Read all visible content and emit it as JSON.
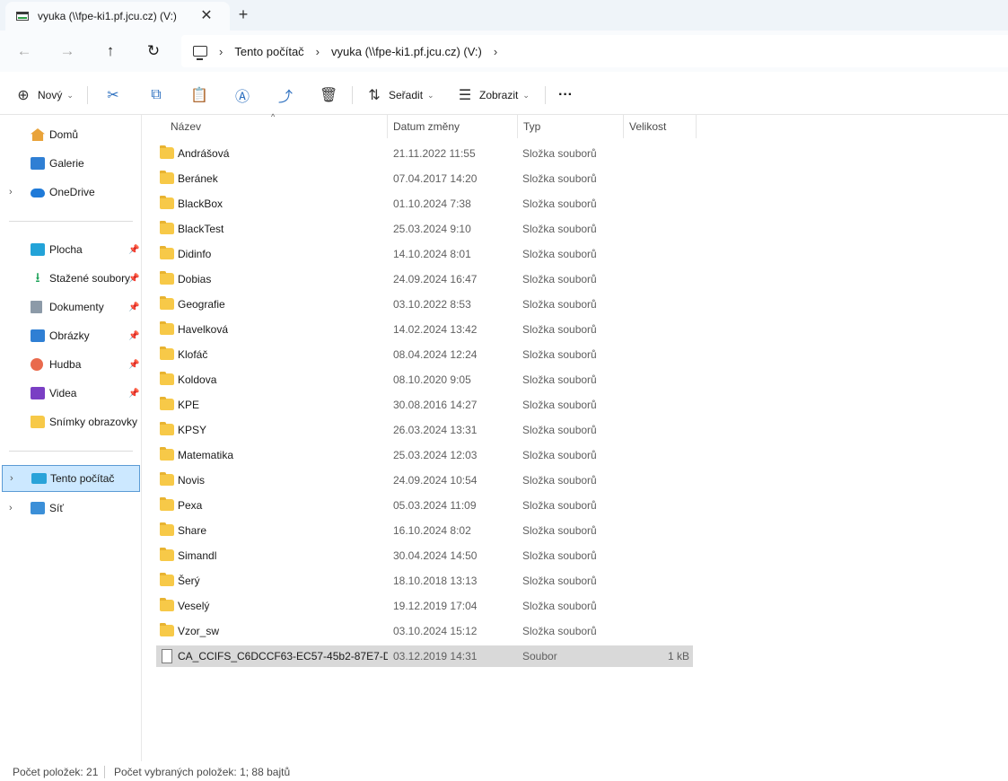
{
  "tab": {
    "title": "vyuka (\\\\fpe-ki1.pf.jcu.cz) (V:)",
    "close": "✕",
    "add": "+"
  },
  "nav": {
    "back": "←",
    "forward": "→",
    "up": "↑",
    "refresh": "↻"
  },
  "breadcrumb": [
    "Tento počítač",
    "vyuka (\\\\fpe-ki1.pf.jcu.cz) (V:)"
  ],
  "toolbar": {
    "new_label": "Nový",
    "sort_label": "Seřadit",
    "view_label": "Zobrazit",
    "more_label": "···",
    "icons": {
      "new": "⊕",
      "cut": "✂",
      "copy": "⧉",
      "paste": "📋",
      "rename": "Ⓐ",
      "share": "⤴",
      "delete": "🗑",
      "sort": "⇅",
      "view": "☰"
    }
  },
  "sidebar": {
    "top": [
      {
        "label": "Domů",
        "icon": "home-icon"
      },
      {
        "label": "Galerie",
        "icon": "gallery-icon"
      },
      {
        "label": "OneDrive",
        "icon": "cloud-icon",
        "expandable": true
      }
    ],
    "pinned": [
      {
        "label": "Plocha",
        "icon": "desktop-icon",
        "pinned": true
      },
      {
        "label": "Stažené soubory",
        "icon": "download-icon",
        "pinned": true
      },
      {
        "label": "Dokumenty",
        "icon": "documents-icon",
        "pinned": true
      },
      {
        "label": "Obrázky",
        "icon": "pictures-icon",
        "pinned": true
      },
      {
        "label": "Hudba",
        "icon": "music-icon",
        "pinned": true
      },
      {
        "label": "Videa",
        "icon": "video-icon",
        "pinned": true
      },
      {
        "label": "Snímky obrazovky",
        "icon": "folder-icon",
        "pinned": false
      }
    ],
    "bottom": [
      {
        "label": "Tento počítač",
        "icon": "computer-icon",
        "selected": true
      },
      {
        "label": "Síť",
        "icon": "network-icon"
      }
    ]
  },
  "columns": {
    "name": "Název",
    "date": "Datum změny",
    "type": "Typ",
    "size": "Velikost"
  },
  "files": [
    {
      "name": "Andrášová",
      "date": "21.11.2022 11:55",
      "type": "Složka souborů",
      "size": "",
      "kind": "folder"
    },
    {
      "name": "Beránek",
      "date": "07.04.2017 14:20",
      "type": "Složka souborů",
      "size": "",
      "kind": "folder"
    },
    {
      "name": "BlackBox",
      "date": "01.10.2024 7:38",
      "type": "Složka souborů",
      "size": "",
      "kind": "folder"
    },
    {
      "name": "BlackTest",
      "date": "25.03.2024 9:10",
      "type": "Složka souborů",
      "size": "",
      "kind": "folder"
    },
    {
      "name": "Didinfo",
      "date": "14.10.2024 8:01",
      "type": "Složka souborů",
      "size": "",
      "kind": "folder"
    },
    {
      "name": "Dobias",
      "date": "24.09.2024 16:47",
      "type": "Složka souborů",
      "size": "",
      "kind": "folder"
    },
    {
      "name": "Geografie",
      "date": "03.10.2022 8:53",
      "type": "Složka souborů",
      "size": "",
      "kind": "folder"
    },
    {
      "name": "Havelková",
      "date": "14.02.2024 13:42",
      "type": "Složka souborů",
      "size": "",
      "kind": "folder"
    },
    {
      "name": "Klofáč",
      "date": "08.04.2024 12:24",
      "type": "Složka souborů",
      "size": "",
      "kind": "folder"
    },
    {
      "name": "Koldova",
      "date": "08.10.2020 9:05",
      "type": "Složka souborů",
      "size": "",
      "kind": "folder"
    },
    {
      "name": "KPE",
      "date": "30.08.2016 14:27",
      "type": "Složka souborů",
      "size": "",
      "kind": "folder"
    },
    {
      "name": "KPSY",
      "date": "26.03.2024 13:31",
      "type": "Složka souborů",
      "size": "",
      "kind": "folder"
    },
    {
      "name": "Matematika",
      "date": "25.03.2024 12:03",
      "type": "Složka souborů",
      "size": "",
      "kind": "folder"
    },
    {
      "name": "Novis",
      "date": "24.09.2024 10:54",
      "type": "Složka souborů",
      "size": "",
      "kind": "folder"
    },
    {
      "name": "Pexa",
      "date": "05.03.2024 11:09",
      "type": "Složka souborů",
      "size": "",
      "kind": "folder"
    },
    {
      "name": "Share",
      "date": "16.10.2024 8:02",
      "type": "Složka souborů",
      "size": "",
      "kind": "folder"
    },
    {
      "name": "Simandl",
      "date": "30.04.2024 14:50",
      "type": "Složka souborů",
      "size": "",
      "kind": "folder"
    },
    {
      "name": "Šerý",
      "date": "18.10.2018 13:13",
      "type": "Složka souborů",
      "size": "",
      "kind": "folder"
    },
    {
      "name": "Veselý",
      "date": "19.12.2019 17:04",
      "type": "Složka souborů",
      "size": "",
      "kind": "folder"
    },
    {
      "name": "Vzor_sw",
      "date": "03.10.2024 15:12",
      "type": "Složka souborů",
      "size": "",
      "kind": "folder"
    },
    {
      "name": "CA_CCIFS_C6DCCF63-EC57-45b2-87E7-D...",
      "date": "03.12.2019 14:31",
      "type": "Soubor",
      "size": "1 kB",
      "kind": "file",
      "selected": true
    }
  ],
  "status": {
    "count": "Počet položek: 21",
    "selected": "Počet vybraných položek: 1; 88 bajtů"
  }
}
